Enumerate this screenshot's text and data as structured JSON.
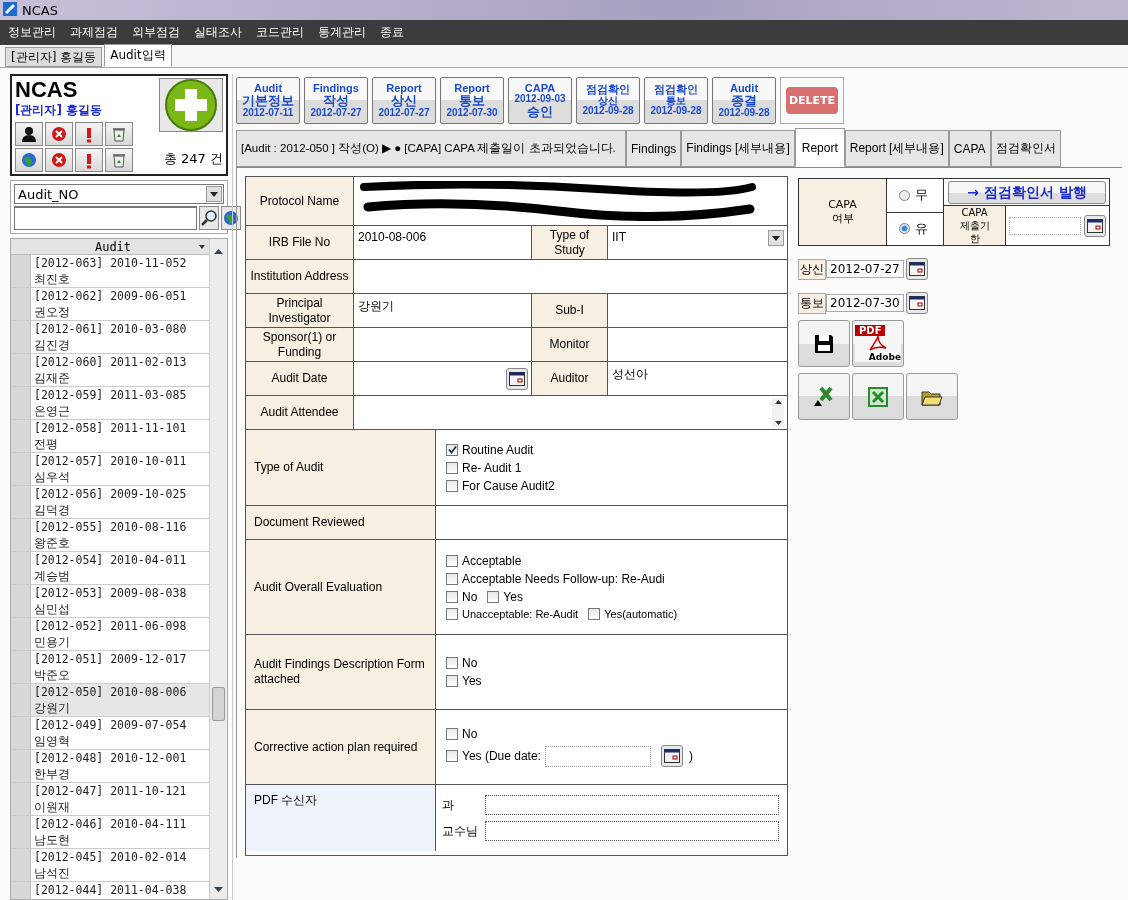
{
  "window": {
    "title": "NCAS"
  },
  "menu": [
    "정보관리",
    "과제점검",
    "외부점검",
    "실태조사",
    "코드관리",
    "통계관리",
    "종료"
  ],
  "doc_tabs": [
    {
      "label": "[관리자] 홍길동",
      "selected": false
    },
    {
      "label": "Audit입력",
      "selected": true
    }
  ],
  "sidebar": {
    "logo": "NCAS",
    "user": "[관리자] 홍길동",
    "count": "총 247 건",
    "search_by": "Audit_NO",
    "list_column": "Audit",
    "rows": [
      {
        "code": "[2012-063] 2010-11-052",
        "name": "최진호",
        "selected": false
      },
      {
        "code": "[2012-062] 2009-06-051",
        "name": "권오정",
        "selected": false
      },
      {
        "code": "[2012-061] 2010-03-080",
        "name": "김진경",
        "selected": false
      },
      {
        "code": "[2012-060] 2011-02-013",
        "name": "김재준",
        "selected": false
      },
      {
        "code": "[2012-059] 2011-03-085",
        "name": "온영근",
        "selected": false
      },
      {
        "code": "[2012-058] 2011-11-101",
        "name": "전평",
        "selected": false
      },
      {
        "code": "[2012-057] 2010-10-011",
        "name": "심우석",
        "selected": false
      },
      {
        "code": "[2012-056] 2009-10-025",
        "name": "김덕경",
        "selected": false
      },
      {
        "code": "[2012-055] 2010-08-116",
        "name": "왕준호",
        "selected": false
      },
      {
        "code": "[2012-054] 2010-04-011",
        "name": "계승범",
        "selected": false
      },
      {
        "code": "[2012-053] 2009-08-038",
        "name": "심민섭",
        "selected": false
      },
      {
        "code": "[2012-052] 2011-06-098",
        "name": "민용기",
        "selected": false
      },
      {
        "code": "[2012-051] 2009-12-017",
        "name": "박준오",
        "selected": false
      },
      {
        "code": "[2012-050] 2010-08-006",
        "name": "강원기",
        "selected": true
      },
      {
        "code": "[2012-049] 2009-07-054",
        "name": "임영혁",
        "selected": false
      },
      {
        "code": "[2012-048] 2010-12-001",
        "name": "한부경",
        "selected": false
      },
      {
        "code": "[2012-047] 2011-10-121",
        "name": "이원재",
        "selected": false
      },
      {
        "code": "[2012-046] 2010-04-111",
        "name": "남도현",
        "selected": false
      },
      {
        "code": "[2012-045] 2010-02-014",
        "name": "남석진",
        "selected": false
      },
      {
        "code": "[2012-044] 2011-04-038",
        "selected": false
      }
    ]
  },
  "workflow_steps": [
    {
      "lines": [
        {
          "kind": "title",
          "text": "Audit"
        },
        {
          "kind": "label",
          "text": "기본정보"
        },
        {
          "kind": "date",
          "text": "2012-07-11"
        }
      ]
    },
    {
      "lines": [
        {
          "kind": "title",
          "text": "Findings"
        },
        {
          "kind": "label",
          "text": "작성"
        },
        {
          "kind": "date",
          "text": "2012-07-27"
        }
      ]
    },
    {
      "lines": [
        {
          "kind": "title",
          "text": "Report"
        },
        {
          "kind": "label",
          "text": "상신"
        },
        {
          "kind": "date",
          "text": "2012-07-27"
        }
      ]
    },
    {
      "lines": [
        {
          "kind": "title",
          "text": "Report"
        },
        {
          "kind": "label",
          "text": "통보"
        },
        {
          "kind": "date",
          "text": "2012-07-30"
        }
      ]
    },
    {
      "lines": [
        {
          "kind": "title",
          "text": "CAPA"
        },
        {
          "kind": "date",
          "text": "2012-09-03"
        },
        {
          "kind": "label",
          "text": "승인"
        }
      ]
    },
    {
      "lines": [
        {
          "kind": "title",
          "text": "점검확인"
        },
        {
          "kind": "small",
          "text": "상신"
        },
        {
          "kind": "date",
          "text": "2012-09-28"
        }
      ]
    },
    {
      "lines": [
        {
          "kind": "title",
          "text": "점검확인"
        },
        {
          "kind": "small",
          "text": "통보"
        },
        {
          "kind": "date",
          "text": "2012-09-28"
        }
      ]
    },
    {
      "lines": [
        {
          "kind": "title",
          "text": "Audit"
        },
        {
          "kind": "label",
          "text": "종결"
        },
        {
          "kind": "date",
          "text": "2012-09-28"
        }
      ]
    }
  ],
  "delete_button": "DELETE",
  "status_message": "[Audit : 2012-050 ] 작성(O) ▶ ● [CAPA] CAPA 제출일이 초과되었습니다.",
  "tabs": [
    {
      "label": "Findings",
      "selected": false
    },
    {
      "label": "Findings [세부내용]",
      "selected": false
    },
    {
      "label": "Report",
      "selected": true
    },
    {
      "label": "Report [세부내용]",
      "selected": false
    },
    {
      "label": "CAPA",
      "selected": false
    },
    {
      "label": "점검확인서",
      "selected": false
    }
  ],
  "info_rows": [
    {
      "cells": [
        {
          "label": "Protocol Name",
          "kind": "redacted"
        }
      ]
    },
    {
      "cells": [
        {
          "label": "IRB File No",
          "kind": "text",
          "value": "2010-08-006"
        },
        {
          "label": "Type of Study",
          "kind": "select",
          "value": "IIT"
        }
      ]
    },
    {
      "cells": [
        {
          "label": "Institution Address",
          "kind": "text"
        }
      ]
    },
    {
      "cells": [
        {
          "label": "Principal Investigator",
          "kind": "text",
          "value": "강원기"
        },
        {
          "label": "Sub-I",
          "kind": "text"
        }
      ]
    },
    {
      "cells": [
        {
          "label": "Sponsor(1) or Funding",
          "kind": "text"
        },
        {
          "label": "Monitor",
          "kind": "text"
        }
      ]
    },
    {
      "cells": [
        {
          "label": "Audit Date",
          "kind": "date"
        },
        {
          "label": "Auditor",
          "kind": "text",
          "value": "성선아"
        }
      ]
    },
    {
      "cells": [
        {
          "label": "Audit Attendee",
          "kind": "textarea"
        }
      ]
    }
  ],
  "sections": [
    {
      "label": "Type of Audit",
      "kind": "options",
      "lines": [
        [
          {
            "kind": "checkbox",
            "label": "Routine Audit",
            "checked": true
          }
        ],
        [
          {
            "kind": "checkbox",
            "label": "Re- Audit 1",
            "checked": false
          }
        ],
        [
          {
            "kind": "checkbox",
            "label": "For Cause Audit2",
            "checked": false
          }
        ]
      ]
    },
    {
      "label": "Document Reviewed",
      "kind": "options"
    },
    {
      "label": "Audit Overall Evaluation",
      "kind": "options",
      "lines": [
        [
          {
            "kind": "checkbox",
            "label": "Acceptable",
            "checked": false
          }
        ],
        [
          {
            "kind": "checkbox",
            "label": "Acceptable Needs Follow-up: Re-Audi",
            "checked": false
          }
        ],
        [
          {
            "kind": "checkbox",
            "label": "No",
            "checked": false
          },
          {
            "kind": "checkbox",
            "label": "Yes",
            "checked": false
          }
        ],
        [
          {
            "kind": "checkbox",
            "label": "Unacceptable: Re-Audit",
            "checked": false,
            "small": true
          },
          {
            "kind": "checkbox",
            "label": "Yes(automatic)",
            "checked": false,
            "small": true
          }
        ]
      ]
    },
    {
      "label": "Audit Findings Description Form attached",
      "kind": "options",
      "lines": [
        [
          {
            "kind": "checkbox",
            "label": "No",
            "checked": false
          }
        ],
        [
          {
            "kind": "checkbox",
            "label": "Yes",
            "checked": false
          }
        ]
      ]
    },
    {
      "label": "Corrective action plan required",
      "kind": "options",
      "lines": [
        [
          {
            "kind": "checkbox",
            "label": "No",
            "checked": false
          }
        ],
        [
          {
            "kind": "checkbox",
            "label": "Yes (Due date:",
            "checked": false
          },
          {
            "kind": "date_field"
          },
          {
            "kind": "text",
            "label": ")"
          }
        ]
      ]
    },
    {
      "label": "PDF 수신자",
      "kind": "recipients",
      "fields": [
        {
          "label": "과"
        },
        {
          "label": "교수님"
        }
      ]
    }
  ],
  "capa": {
    "label": "CAPA 여부",
    "options": [
      {
        "label": "무",
        "selected": false
      },
      {
        "label": "유",
        "selected": true
      }
    ],
    "issue_button": "→ 점검확인서 발행",
    "deadline_label": "CAPA 제출기한"
  },
  "date_rows": [
    {
      "label": "상신",
      "value": "2012-07-27"
    },
    {
      "label": "통보",
      "value": "2012-07-30"
    }
  ],
  "pdf_icon": {
    "top": "PDF",
    "bottom": "Adobe"
  }
}
